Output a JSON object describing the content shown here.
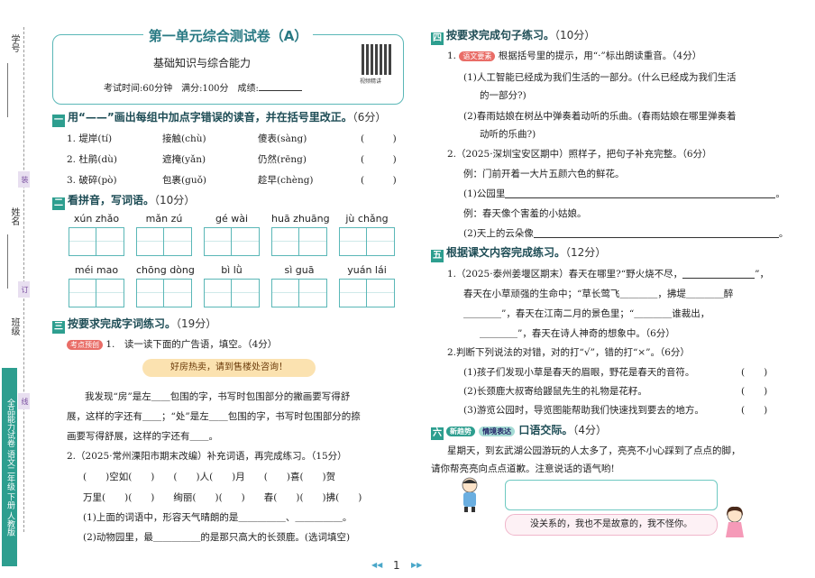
{
  "binding": {
    "student_no": "学号",
    "name": "姓名",
    "class": "班级",
    "book": "全品能力试卷 语文二年级 下册 人教版"
  },
  "header": {
    "title": "第一单元综合测试卷（A）",
    "subtitle": "基础知识与综合能力",
    "meta": "考试时间:60分钟　满分:100分　成绩:",
    "qr_caption": "视频精讲"
  },
  "s1": {
    "num": "一",
    "title": "用“——”画出每组中加点字错误的读音，并在括号里改正。",
    "pts": "（6分）",
    "rows": [
      [
        "1. 堤岸(tí)",
        "接触(chù)",
        "傻表(sàng)",
        "(　　　)"
      ],
      [
        "2. 杜鹃(dù)",
        "遮掩(yǎn)",
        "仍然(rēng)",
        "(　　　)"
      ],
      [
        "3. 破碎(pò)",
        "包裹(guǒ)",
        "趁早(chèng)",
        "(　　　)"
      ]
    ]
  },
  "s2": {
    "num": "二",
    "title": "看拼音，写词语。",
    "pts": "（10分）",
    "row1": [
      "xún zhǎo",
      "mǎn zú",
      "gé wài",
      "huā zhuāng",
      "jù chǎng"
    ],
    "row2": [
      "méi mao",
      "chōng dòng",
      "bì lǜ",
      "sì guā",
      "yuán lái"
    ]
  },
  "s3": {
    "num": "三",
    "title": "按要求完成字词练习。",
    "pts": "（19分）",
    "q1_tag": "考点预创",
    "q1": "1.　读一读下面的广告语，填空。（4分）",
    "ad": "好房热卖，请到售楼处咨询！",
    "p1": "我发现“房”是左＿＿包围的字，书写时包围部分的撇画要写得舒",
    "p2": "展，这样的字还有＿＿；“处”是左＿＿包围的字，书写时包围部分的捺",
    "p3": "画要写得舒展，这样的字还有＿＿。",
    "q2": "2.（2025·常州溧阳市期末改编）补充词语，再完成练习。（15分）",
    "w1": "(　　)空如(　　)　　(　　)人(　　)月　　(　　)喜(　　)贺",
    "w2": "万里(　　)(　　)　　绚丽(　　)(　　)　　春(　　)(　　)拂(　　)",
    "w3": "(1)上面的词语中，形容天气晴朗的是＿＿＿＿＿、＿＿＿＿＿。",
    "w4": "(2)动物园里，最＿＿＿＿＿的是那只高大的长颈鹿。(选词填空)"
  },
  "s4": {
    "num": "四",
    "title": "按要求完成句子练习。",
    "pts": "（10分）",
    "q1_tag": "语文要素",
    "q1": "根据括号里的提示，用“·”标出朗读重音。（4分）",
    "a1": "(1)人工智能已经成为我们生活的一部分。(什么已经成为我们生活",
    "a1b": "的一部分?)",
    "a2": "(2)春雨姑娘在树丛中弹奏着动听的乐曲。(春雨姑娘在哪里弹奏着",
    "a2b": "动听的乐曲?)",
    "q2": "2.（2025·深圳宝安区期中）照样子，把句子补充完整。（6分）",
    "e1": "例：门前开着一大片五颜六色的鲜花。",
    "b1": "(1)公园里",
    "e2": "例：春天像个害羞的小姑娘。",
    "b2": "(2)天上的云朵像"
  },
  "s5": {
    "num": "五",
    "title": "根据课文内容完成练习。",
    "pts": "（12分）",
    "q1": "1.（2025·泰州姜堰区期末）春天在哪里?“野火烧不尽，",
    "q1b": "春天在小草顽强的生命中；“草长莺飞＿＿＿＿，拂堤＿＿＿＿醉",
    "q1c": "＿＿＿＿”，春天在江南二月的景色里；“＿＿＿＿谁裁出，",
    "q1d": "＿＿＿＿”，春天在诗人神奇的想象中。（6分）",
    "q2": "2.判断下列说法的对错，对的打“√”，错的打“×”。（6分）",
    "j1": "(1)孩子们发现小草是春天的眉眼，野花是春天的音符。",
    "j2": "(2)长颈鹿大叔寄给鼹鼠先生的礼物是花籽。",
    "j3": "(3)游览公园时，导览图能帮助我们快速找到要去的地方。",
    "paren": "(　　)"
  },
  "s6": {
    "num": "六",
    "tag1": "新趋势",
    "tag2": "情境表达",
    "title": "口语交际。",
    "pts": "（4分）",
    "p1": "星期天，到玄武湖公园游玩的人太多了，亮亮不小心踩到了点点的脚，",
    "p2": "请你帮亮亮向点点道歉。注意说话的语气哟!",
    "reply": "没关系的，我也不是故意的，我不怪你。"
  },
  "page_number": "1"
}
